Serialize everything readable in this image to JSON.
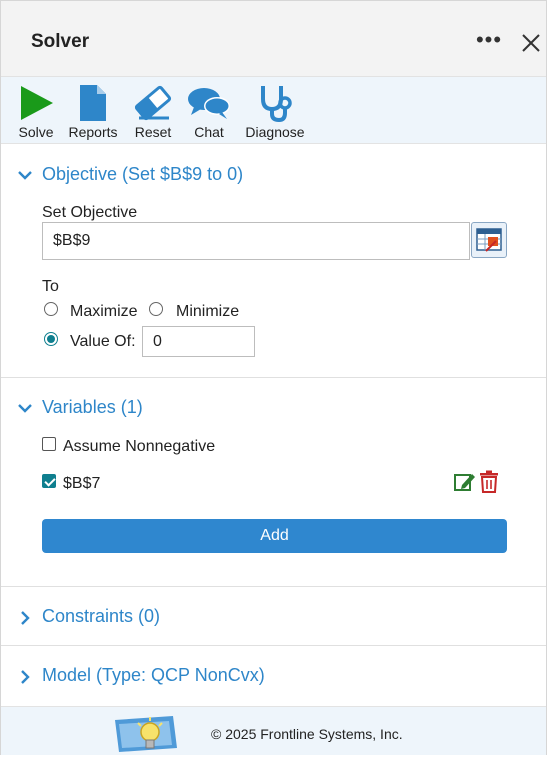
{
  "header": {
    "title": "Solver",
    "more_label": "•••"
  },
  "toolbar": {
    "solve": "Solve",
    "reports": "Reports",
    "reset": "Reset",
    "chat": "Chat",
    "diagnose": "Diagnose"
  },
  "objective": {
    "title": "Objective (Set $B$9 to 0)",
    "set_label": "Set Objective",
    "cell": "$B$9",
    "to_label": "To",
    "maximize": "Maximize",
    "minimize": "Minimize",
    "value_of": "Value Of:",
    "value": "0",
    "selected": "value_of"
  },
  "variables": {
    "title": "Variables (1)",
    "assume_nonneg": "Assume Nonnegative",
    "assume_nonneg_checked": false,
    "items": [
      {
        "cell": "$B$7",
        "checked": true
      }
    ],
    "add_label": "Add"
  },
  "constraints": {
    "title": "Constraints (0)"
  },
  "model": {
    "title": "Model (Type: QCP NonCvx)"
  },
  "footer": {
    "copyright": "© 2025 Frontline Systems, Inc."
  },
  "colors": {
    "accent": "#2e86c9",
    "solve_green": "#1a9a1a",
    "teal": "#0f7f8f",
    "edit_green": "#2e7d32",
    "delete_red": "#c62828"
  }
}
